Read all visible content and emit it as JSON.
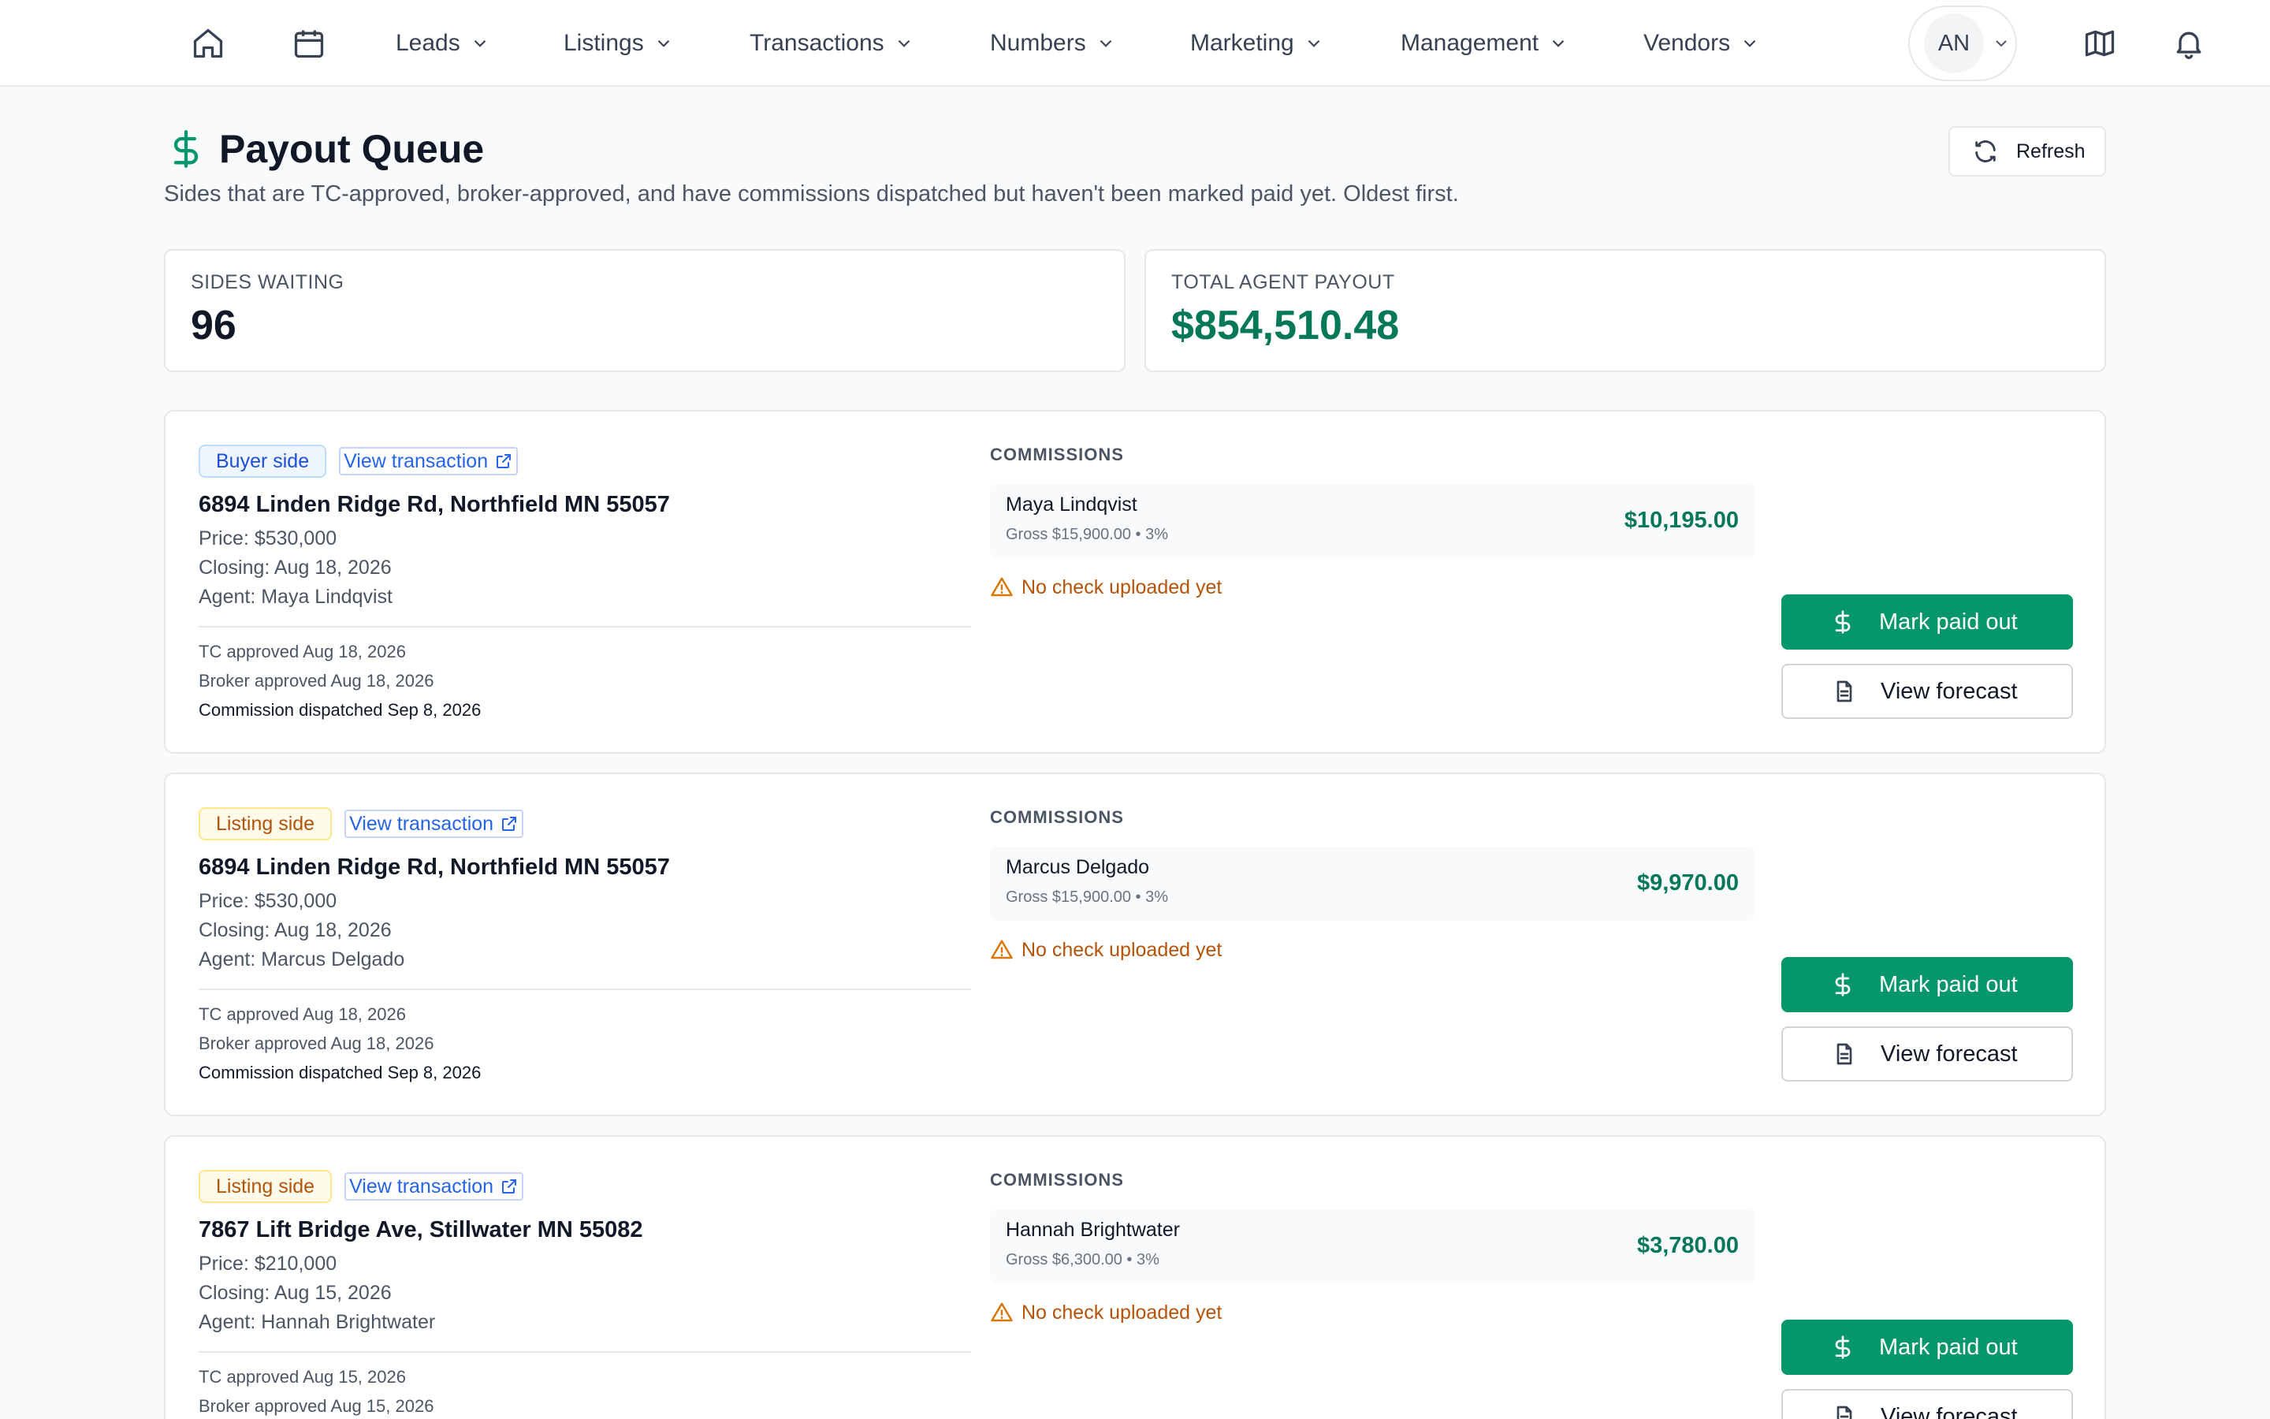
{
  "nav": {
    "home_icon": "home-icon",
    "calendar_icon": "calendar-icon",
    "menus": [
      "Leads",
      "Listings",
      "Transactions",
      "Numbers",
      "Marketing",
      "Management",
      "Vendors"
    ],
    "account_initials": "AN",
    "map_icon": "map-icon",
    "bell_icon": "bell-icon"
  },
  "page": {
    "title": "Payout Queue",
    "subtitle": "Sides that are TC-approved, broker-approved, and have commissions dispatched but haven't been marked paid yet. Oldest first.",
    "refresh_label": "Refresh"
  },
  "stats": {
    "sides_waiting_label": "SIDES WAITING",
    "sides_waiting_value": "96",
    "total_payout_label": "TOTAL AGENT PAYOUT",
    "total_payout_value": "$854,510.48"
  },
  "colors": {
    "accent_green": "#059669",
    "money_green": "#047857",
    "warning_amber": "#b45309",
    "link_blue": "#2563eb"
  },
  "cards": [
    {
      "side": "Buyer side",
      "side_type": "buyer",
      "view_link": "View transaction",
      "address": "6894 Linden Ridge Rd, Northfield MN 55057",
      "price": "Price: $530,000",
      "closing": "Closing: Aug 18, 2026",
      "agent": "Agent: Maya Lindqvist",
      "tc_approved": "TC approved Aug 18, 2026",
      "broker_approved": "Broker approved Aug 18, 2026",
      "dispatched": "Commission dispatched Sep 8, 2026",
      "commissions_label": "COMMISSIONS",
      "commission_agent": "Maya Lindqvist",
      "commission_gross": "Gross $15,900.00 • 3%",
      "commission_amount": "$10,195.00",
      "warning": "No check uploaded yet",
      "mark_paid_label": "Mark paid out",
      "view_forecast_label": "View forecast"
    },
    {
      "side": "Listing side",
      "side_type": "listing",
      "view_link": "View transaction",
      "address": "6894 Linden Ridge Rd, Northfield MN 55057",
      "price": "Price: $530,000",
      "closing": "Closing: Aug 18, 2026",
      "agent": "Agent: Marcus Delgado",
      "tc_approved": "TC approved Aug 18, 2026",
      "broker_approved": "Broker approved Aug 18, 2026",
      "dispatched": "Commission dispatched Sep 8, 2026",
      "commissions_label": "COMMISSIONS",
      "commission_agent": "Marcus Delgado",
      "commission_gross": "Gross $15,900.00 • 3%",
      "commission_amount": "$9,970.00",
      "warning": "No check uploaded yet",
      "mark_paid_label": "Mark paid out",
      "view_forecast_label": "View forecast"
    },
    {
      "side": "Listing side",
      "side_type": "listing",
      "view_link": "View transaction",
      "address": "7867 Lift Bridge Ave, Stillwater MN 55082",
      "price": "Price: $210,000",
      "closing": "Closing: Aug 15, 2026",
      "agent": "Agent: Hannah Brightwater",
      "tc_approved": "TC approved Aug 15, 2026",
      "broker_approved": "Broker approved Aug 15, 2026",
      "dispatched": "",
      "commissions_label": "COMMISSIONS",
      "commission_agent": "Hannah Brightwater",
      "commission_gross": "Gross $6,300.00 • 3%",
      "commission_amount": "$3,780.00",
      "warning": "No check uploaded yet",
      "mark_paid_label": "Mark paid out",
      "view_forecast_label": "View forecast"
    }
  ]
}
